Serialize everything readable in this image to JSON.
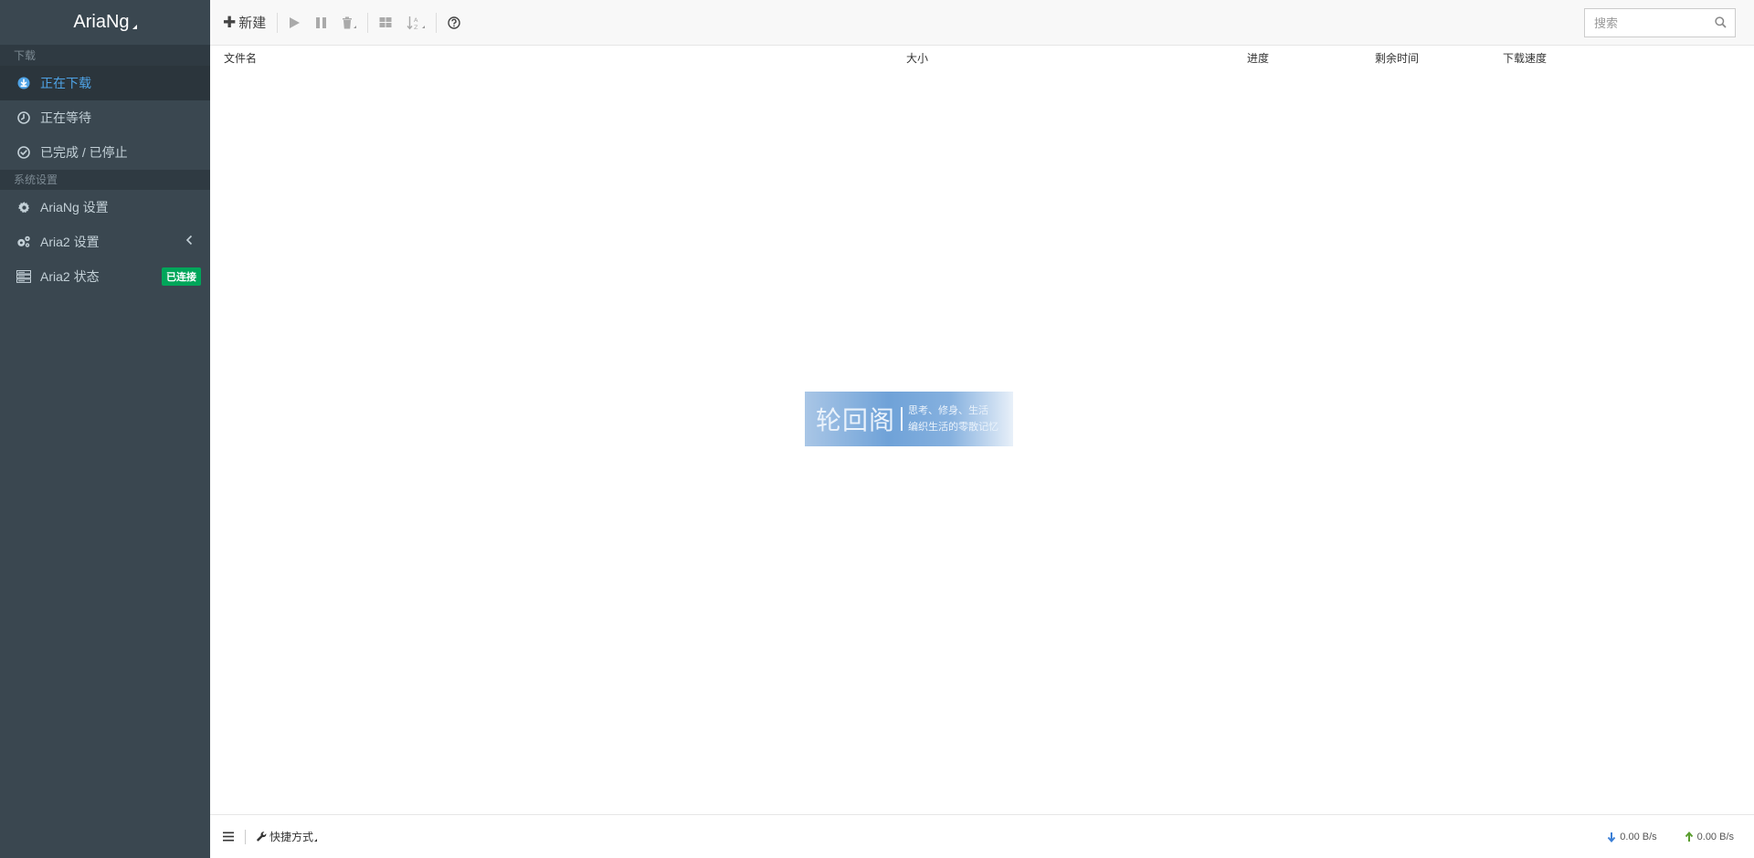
{
  "app": {
    "title": "AriaNg"
  },
  "sidebar": {
    "sections": [
      {
        "header": "下载",
        "items": [
          {
            "label": "正在下载",
            "icon": "download-circle-icon",
            "active": true
          },
          {
            "label": "正在等待",
            "icon": "clock-icon"
          },
          {
            "label": "已完成 / 已停止",
            "icon": "check-circle-icon"
          }
        ]
      },
      {
        "header": "系统设置",
        "items": [
          {
            "label": "AriaNg 设置",
            "icon": "gear-icon"
          },
          {
            "label": "Aria2 设置",
            "icon": "gears-icon"
          },
          {
            "label": "Aria2 状态",
            "icon": "server-icon",
            "badge": "已连接",
            "badge_color": "#00a65a"
          }
        ]
      }
    ]
  },
  "toolbar": {
    "new_label": "新建",
    "search_placeholder": "搜索"
  },
  "table": {
    "columns": [
      "文件名",
      "大小",
      "进度",
      "剩余时间",
      "下载速度"
    ]
  },
  "watermark": {
    "main": "轮回阁",
    "line1": "思考、修身、生活",
    "line2": "编织生活的零散记忆"
  },
  "footer": {
    "shortcut_label": "快捷方式",
    "download_speed": "0.00 B/s",
    "upload_speed": "0.00 B/s"
  },
  "colors": {
    "sidebar_bg": "#3a4750",
    "active_text": "#4fa3e6",
    "badge": "#00a65a",
    "download_arrow": "#3b7fd6",
    "upload_arrow": "#5a9e2f"
  }
}
